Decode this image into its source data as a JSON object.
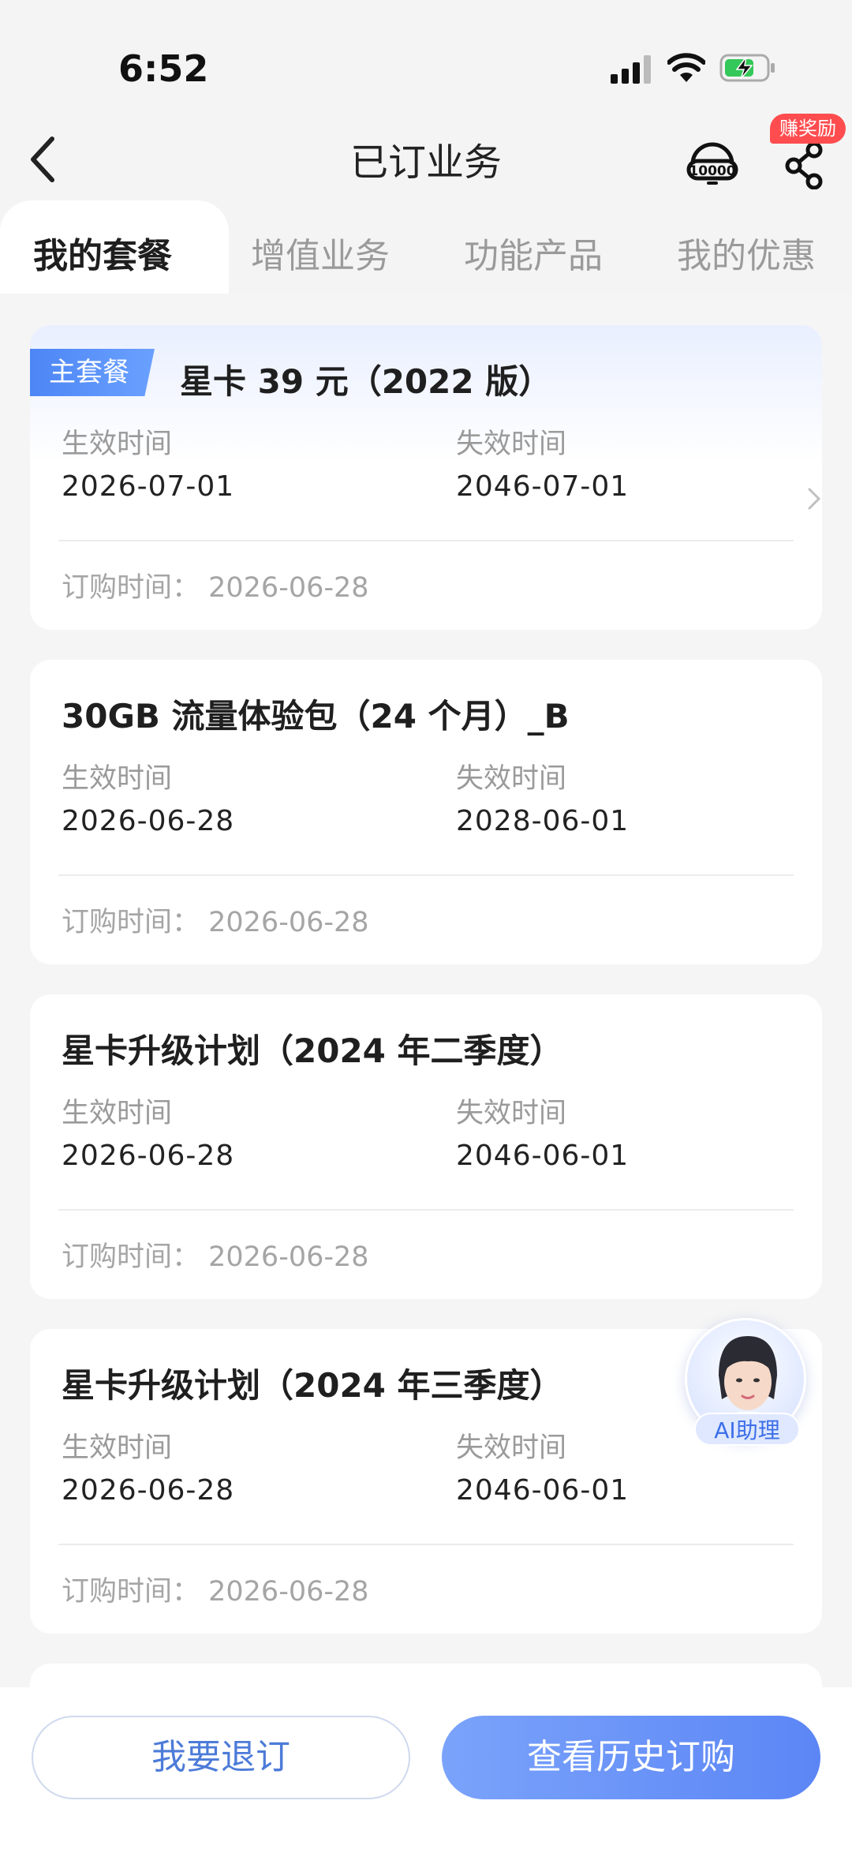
{
  "status_bar": {
    "time": "6:52"
  },
  "header": {
    "title": "已订业务",
    "reward_badge": "赚奖励"
  },
  "tabs": [
    {
      "label": "我的套餐",
      "active": true
    },
    {
      "label": "增值业务",
      "active": false
    },
    {
      "label": "功能产品",
      "active": false
    },
    {
      "label": "我的优惠",
      "active": false
    }
  ],
  "cards": [
    {
      "tag": "主套餐",
      "title": "星卡 39 元（2022 版）",
      "effective_label": "生效时间",
      "effective_date": "2026-07-01",
      "expiry_label": "失效时间",
      "expiry_date": "2046-07-01",
      "order_time": "订购时间：  2026-06-28"
    },
    {
      "title": "30GB 流量体验包（24 个月）_B",
      "effective_label": "生效时间",
      "effective_date": "2026-06-28",
      "expiry_label": "失效时间",
      "expiry_date": "2028-06-01",
      "order_time": "订购时间：  2026-06-28"
    },
    {
      "title": "星卡升级计划（2024 年二季度）",
      "effective_label": "生效时间",
      "effective_date": "2026-06-28",
      "expiry_label": "失效时间",
      "expiry_date": "2046-06-01",
      "order_time": "订购时间：  2026-06-28"
    },
    {
      "title": "星卡升级计划（2024 年三季度）",
      "effective_label": "生效时间",
      "effective_date": "2026-06-28",
      "expiry_label": "失效时间",
      "expiry_date": "2046-06-01",
      "order_time": "订购时间：  2026-06-28"
    }
  ],
  "ai_assistant": {
    "label": "AI助理"
  },
  "bottom": {
    "unsubscribe_label": "我要退订",
    "history_label": "查看历史订购"
  },
  "colors": {
    "accent": "#5c86f5",
    "tag": "#4d86f5",
    "badge": "#ff4d4f"
  }
}
